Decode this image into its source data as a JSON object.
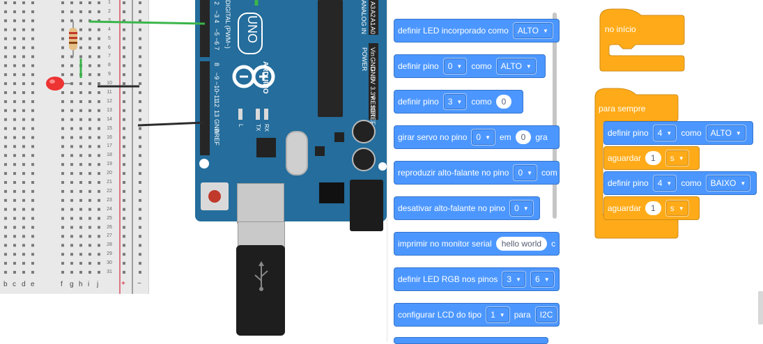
{
  "breadboard": {
    "row_numbers": [
      "1",
      "2",
      "3",
      "4",
      "5",
      "6",
      "7",
      "8",
      "9",
      "10",
      "11",
      "12",
      "13",
      "14",
      "15",
      "16",
      "17",
      "18",
      "19",
      "20",
      "21",
      "22",
      "23",
      "24",
      "25",
      "26",
      "27",
      "28",
      "29",
      "30",
      "31"
    ],
    "left_columns": [
      "b",
      "c",
      "d",
      "e"
    ],
    "right_columns": [
      "f",
      "g",
      "h",
      "i",
      "j"
    ],
    "rail_plus": "+",
    "rail_minus": "−"
  },
  "arduino": {
    "model": "UNO",
    "brand": "ARDUINO",
    "digital_label": "DIGITAL (PWM~)",
    "analog_label": "ANALOG IN",
    "power_label": "POWER",
    "digital_pins": [
      "2",
      "~3",
      "4",
      "~5",
      "~6",
      "7",
      "8",
      "~9",
      "~10",
      "~11",
      "12",
      "13",
      "GND",
      "AREF"
    ],
    "analog_pins": [
      "A3",
      "A2",
      "A1",
      "A0"
    ],
    "power_pins": [
      "Vin",
      "GND",
      "GND",
      "5V",
      "3.3V",
      "RESET",
      "IOREF"
    ],
    "leds": [
      "L",
      "TX",
      "RX"
    ]
  },
  "palette": {
    "blocks": [
      {
        "text": "definir LED incorporado como",
        "dd1": "ALTO"
      },
      {
        "text": "definir pino",
        "dd1": "0",
        "mid": "como",
        "dd2": "ALTO"
      },
      {
        "text": "definir pino",
        "dd1": "3",
        "mid": "como",
        "pill": "0"
      },
      {
        "text": "girar servo no pino",
        "dd1": "0",
        "mid": "em",
        "pill": "0",
        "tail": "gra"
      },
      {
        "text": "reproduzir alto-falante no pino",
        "dd1": "0",
        "tail": "com"
      },
      {
        "text": "desativar alto-falante no pino",
        "dd1": "0"
      },
      {
        "text": "imprimir no monitor serial",
        "pill": "hello world",
        "tail": "c"
      },
      {
        "text": "definir LED RGB nos pinos",
        "dd1": "3",
        "dd2": "6"
      },
      {
        "text": "configurar LCD do tipo",
        "dd1": "1",
        "mid": "para",
        "tail": "I2C"
      }
    ]
  },
  "workspace": {
    "start_hat": "no início",
    "forever": "para sempre",
    "blocks": [
      {
        "text": "definir pino",
        "pin": "4",
        "mid": "como",
        "value": "ALTO"
      },
      {
        "text": "aguardar",
        "amount": "1",
        "unit": "s"
      },
      {
        "text": "definir pino",
        "pin": "4",
        "mid": "como",
        "value": "BAIXO"
      },
      {
        "text": "aguardar",
        "amount": "1",
        "unit": "s"
      }
    ]
  },
  "colors": {
    "motion_blue": "#4c97ff",
    "control_orange": "#ffab19",
    "board_blue": "#246d9c",
    "wire_green": "#3ab54a"
  }
}
